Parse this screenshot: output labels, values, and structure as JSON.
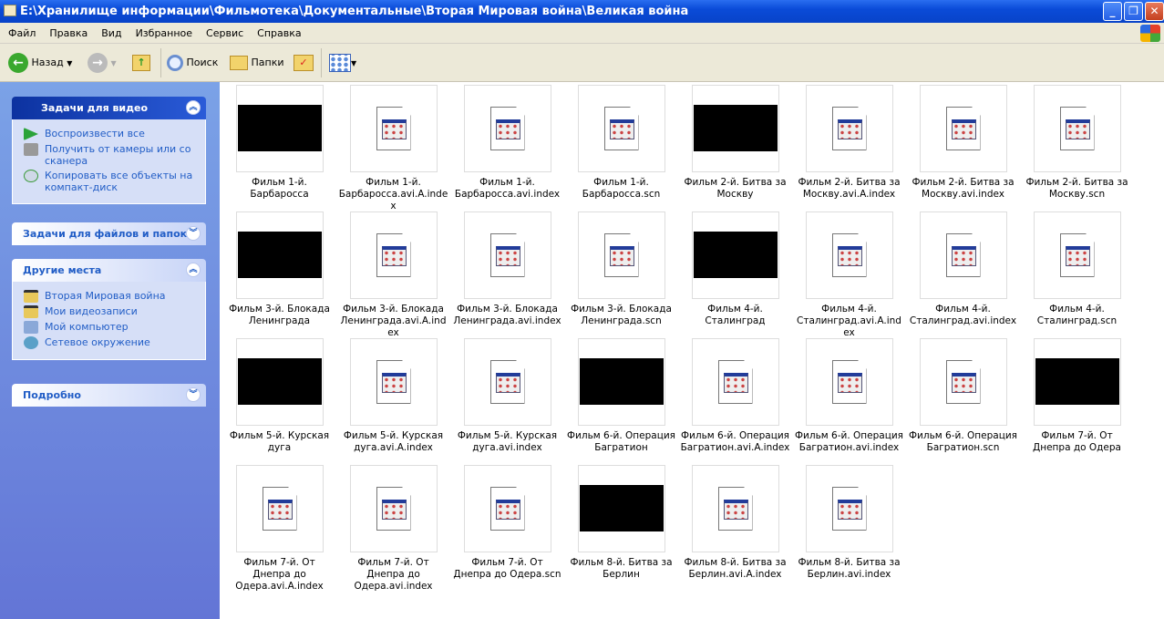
{
  "window": {
    "title": "E:\\Хранилище информации\\Фильмотека\\Документальные\\Вторая Мировая война\\Великая война"
  },
  "menu": [
    "Файл",
    "Правка",
    "Вид",
    "Избранное",
    "Сервис",
    "Справка"
  ],
  "toolbar": {
    "back": "Назад",
    "search": "Поиск",
    "folders": "Папки"
  },
  "sidebar": {
    "video_tasks": {
      "title": "Задачи для видео",
      "items": [
        "Воспроизвести все",
        "Получить от камеры или со сканера",
        "Копировать все объекты на компакт-диск"
      ]
    },
    "file_tasks": {
      "title": "Задачи для файлов и папок"
    },
    "other_places": {
      "title": "Другие места",
      "items": [
        "Вторая Мировая война",
        "Мои видеозаписи",
        "Мой компьютер",
        "Сетевое окружение"
      ]
    },
    "details": {
      "title": "Подробно"
    }
  },
  "items": [
    {
      "name": "Фильм 1-й. Барбаросса",
      "type": "video"
    },
    {
      "name": "Фильм 1-й. Барбаросса.avi.A.index",
      "type": "file"
    },
    {
      "name": "Фильм 1-й. Барбаросса.avi.index",
      "type": "file"
    },
    {
      "name": "Фильм 1-й. Барбаросса.scn",
      "type": "file"
    },
    {
      "name": "Фильм 2-й. Битва за Москву",
      "type": "video"
    },
    {
      "name": "Фильм 2-й. Битва за Москву.avi.A.index",
      "type": "file"
    },
    {
      "name": "Фильм 2-й. Битва за Москву.avi.index",
      "type": "file"
    },
    {
      "name": "Фильм 2-й. Битва за Москву.scn",
      "type": "file"
    },
    {
      "name": "Фильм 3-й. Блокада Ленинграда",
      "type": "video"
    },
    {
      "name": "Фильм 3-й. Блокада Ленинграда.avi.A.index",
      "type": "file"
    },
    {
      "name": "Фильм 3-й. Блокада Ленинграда.avi.index",
      "type": "file"
    },
    {
      "name": "Фильм 3-й. Блокада Ленинграда.scn",
      "type": "file"
    },
    {
      "name": "Фильм 4-й. Сталинград",
      "type": "video"
    },
    {
      "name": "Фильм 4-й. Сталинград.avi.A.index",
      "type": "file"
    },
    {
      "name": "Фильм 4-й. Сталинград.avi.index",
      "type": "file"
    },
    {
      "name": "Фильм 4-й. Сталинград.scn",
      "type": "file"
    },
    {
      "name": "Фильм 5-й. Курская дуга",
      "type": "video"
    },
    {
      "name": "Фильм 5-й. Курская дуга.avi.A.index",
      "type": "file"
    },
    {
      "name": "Фильм 5-й. Курская дуга.avi.index",
      "type": "file"
    },
    {
      "name": "Фильм 6-й. Операция Багратион",
      "type": "video"
    },
    {
      "name": "Фильм 6-й. Операция Багратион.avi.A.index",
      "type": "file"
    },
    {
      "name": "Фильм 6-й. Операция Багратион.avi.index",
      "type": "file"
    },
    {
      "name": "Фильм 6-й. Операция Багратион.scn",
      "type": "file"
    },
    {
      "name": "Фильм 7-й. От Днепра до Одера",
      "type": "video"
    },
    {
      "name": "Фильм 7-й. От Днепра до Одера.avi.A.index",
      "type": "file"
    },
    {
      "name": "Фильм 7-й. От Днепра до Одера.avi.index",
      "type": "file"
    },
    {
      "name": "Фильм 7-й. От Днепра до Одера.scn",
      "type": "file"
    },
    {
      "name": "Фильм 8-й. Битва за Берлин",
      "type": "video"
    },
    {
      "name": "Фильм 8-й. Битва за Берлин.avi.A.index",
      "type": "file"
    },
    {
      "name": "Фильм 8-й. Битва за Берлин.avi.index",
      "type": "file"
    }
  ]
}
